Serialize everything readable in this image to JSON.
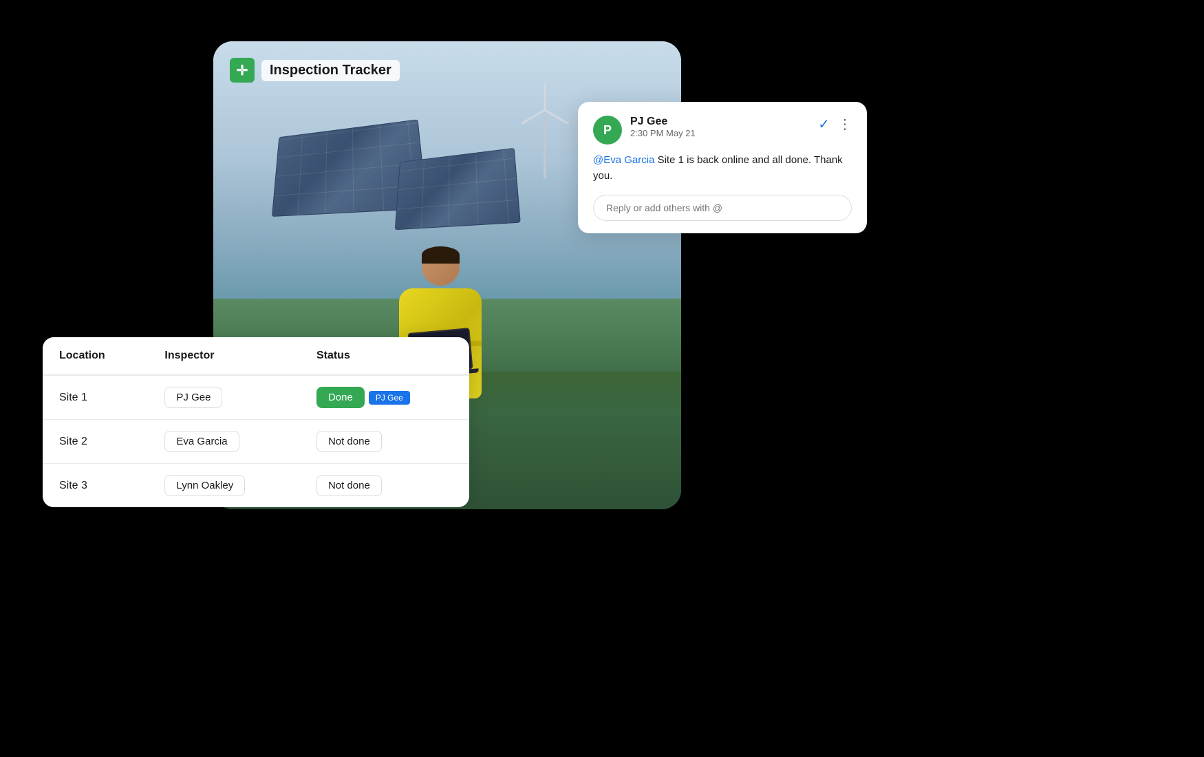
{
  "app": {
    "title": "Inspection Tracker",
    "icon_symbol": "✛"
  },
  "comment_card": {
    "author": "PJ Gee",
    "avatar_initial": "P",
    "time": "2:30 PM May 21",
    "mention": "@Eva Garcia",
    "message_body": " Site 1 is back online and all done. Thank you.",
    "reply_placeholder": "Reply or add others with @"
  },
  "table": {
    "columns": [
      "Location",
      "Inspector",
      "Status"
    ],
    "rows": [
      {
        "location": "Site 1",
        "inspector": "PJ Gee",
        "status": "Done",
        "status_type": "done",
        "cursor_label": "PJ Gee"
      },
      {
        "location": "Site 2",
        "inspector": "Eva Garcia",
        "status": "Not done",
        "status_type": "not-done",
        "cursor_label": ""
      },
      {
        "location": "Site 3",
        "inspector": "Lynn Oakley",
        "status": "Not done",
        "status_type": "not-done",
        "cursor_label": ""
      }
    ]
  },
  "colors": {
    "accent_green": "#34a853",
    "accent_blue": "#1a73e8"
  }
}
